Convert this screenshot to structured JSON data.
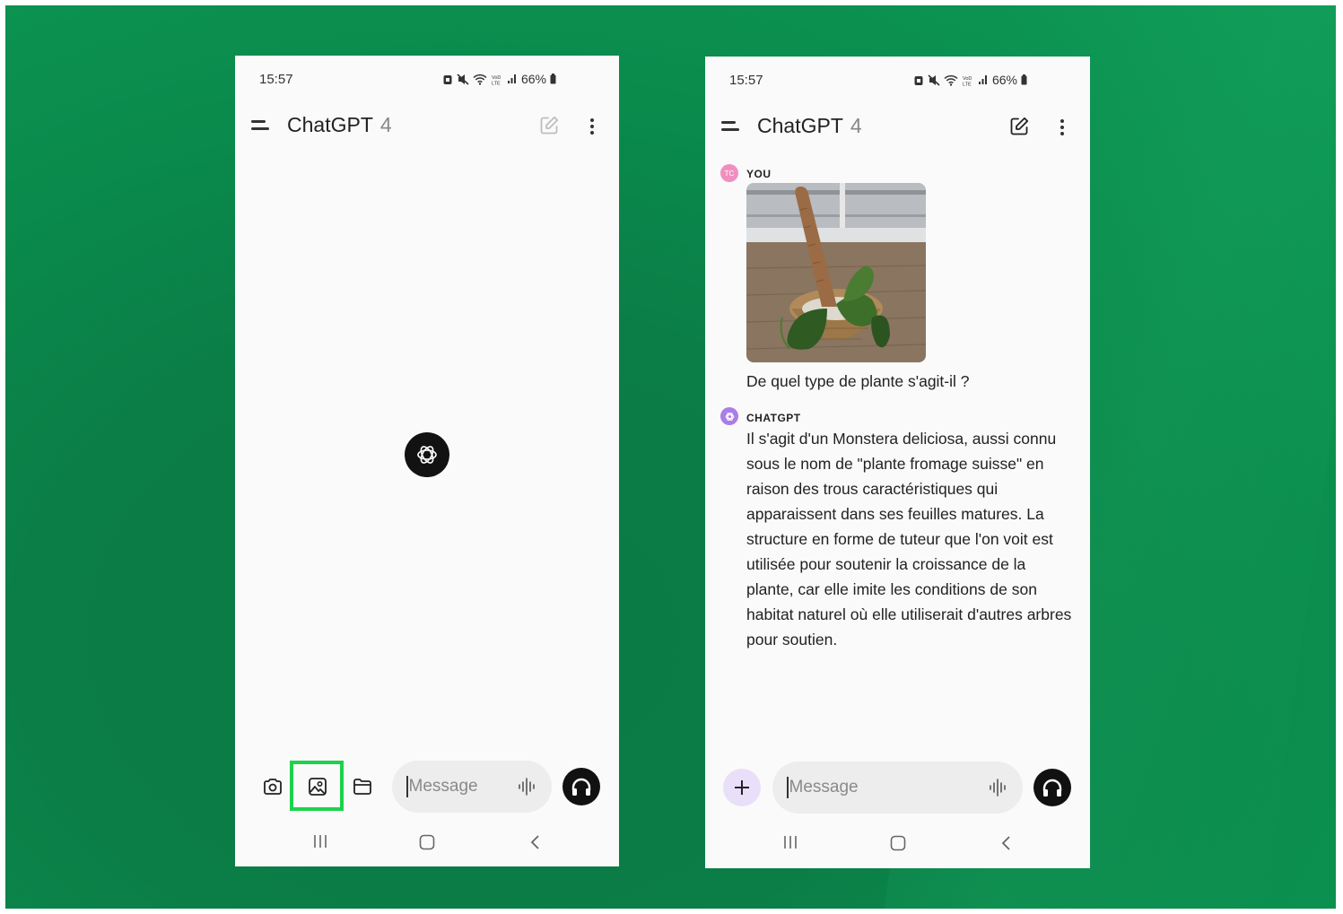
{
  "left_phone": {
    "status": {
      "time": "15:57",
      "battery": "66%"
    },
    "header": {
      "title": "ChatGPT",
      "version": "4"
    },
    "input": {
      "placeholder": "Message"
    },
    "tools": [
      "camera-icon",
      "photo-gallery-icon",
      "folder-icon"
    ],
    "highlight_color": "#1ed24b"
  },
  "right_phone": {
    "status": {
      "time": "15:57",
      "battery": "66%"
    },
    "header": {
      "title": "ChatGPT",
      "version": "4"
    },
    "user": {
      "sender": "YOU",
      "avatar_initials": "TC",
      "message": "De quel type de plante s'agit-il ?"
    },
    "assistant": {
      "sender": "CHATGPT",
      "message": "Il s'agit d'un Monstera deliciosa, aussi connu sous le nom de \"plante fromage suisse\" en raison des trous caractéristiques qui apparaissent dans ses feuilles matures. La structure en forme de tuteur que l'on voit est utilisée pour soutenir la croissance de la plante, car elle imite les conditions de son habitat naturel où elle utiliserait d'autres arbres pour soutien."
    },
    "input": {
      "placeholder": "Message"
    }
  }
}
